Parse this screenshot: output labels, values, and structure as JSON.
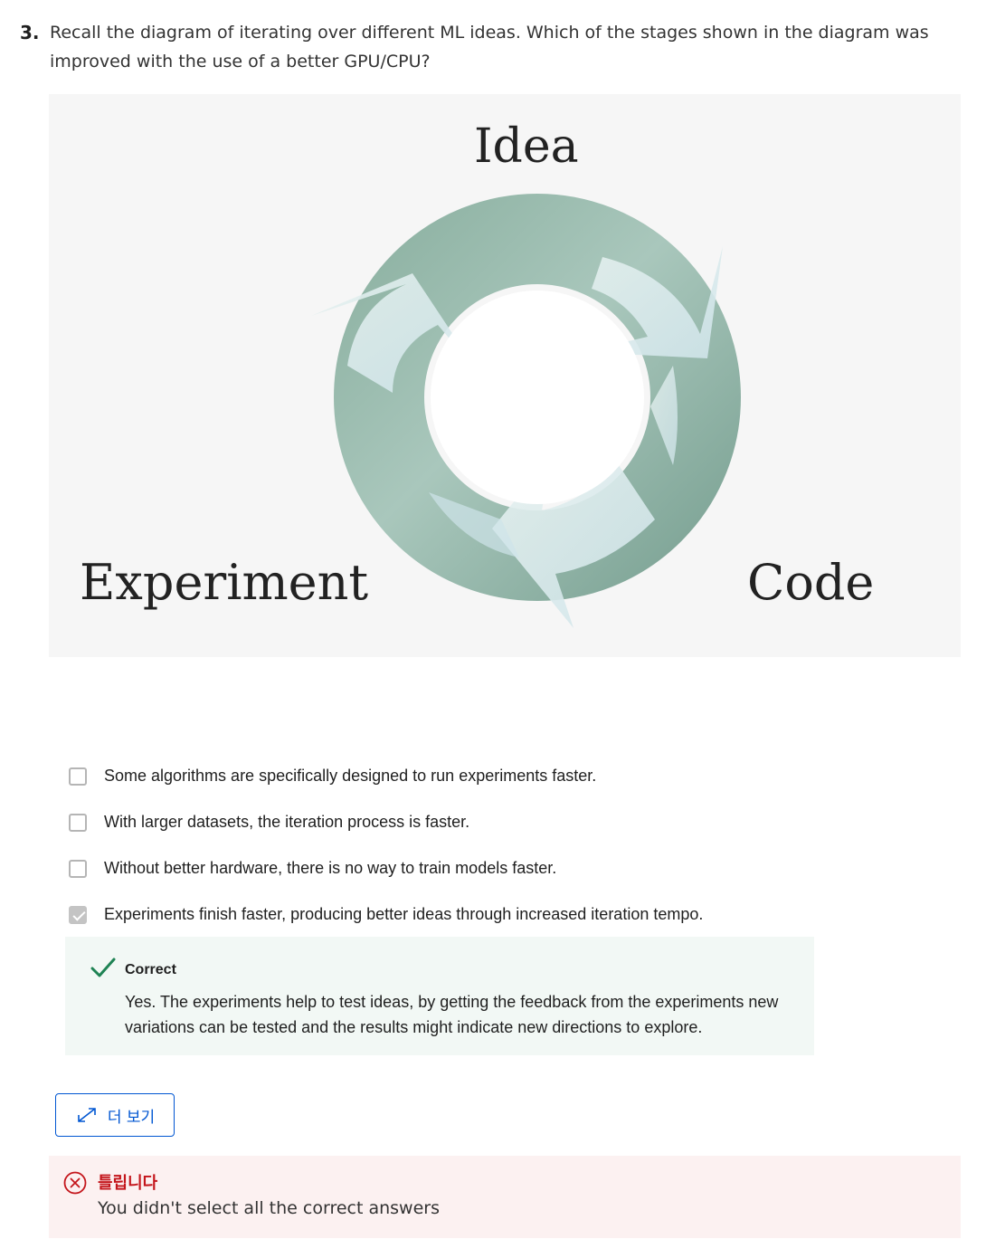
{
  "question": {
    "number": "3.",
    "text": "Recall the diagram of iterating over different ML ideas. Which of the stages shown in the diagram was improved with the use of a better GPU/CPU?"
  },
  "diagram": {
    "labels": {
      "idea": "Idea",
      "experiment": "Experiment",
      "code": "Code"
    }
  },
  "options": [
    {
      "label": "Some algorithms are specifically designed to run experiments faster.",
      "checked": false
    },
    {
      "label": "With larger datasets, the iteration process is faster.",
      "checked": false
    },
    {
      "label": "Without better hardware, there is no way to train models faster.",
      "checked": false
    },
    {
      "label": "Experiments finish faster, producing better ideas through increased iteration tempo.",
      "checked": true
    }
  ],
  "feedback": {
    "title": "Correct",
    "text": "Yes. The experiments help to test ideas, by getting the feedback from the experiments new variations can be tested and the results might indicate new directions to explore."
  },
  "more_button": {
    "label": "더 보기"
  },
  "result": {
    "title": "틀립니다",
    "text": "You didn't select all the correct answers"
  },
  "colors": {
    "accent": "#0056d2",
    "success": "#1f8354",
    "error": "#c4161c",
    "ring": "#8fb3a6"
  }
}
